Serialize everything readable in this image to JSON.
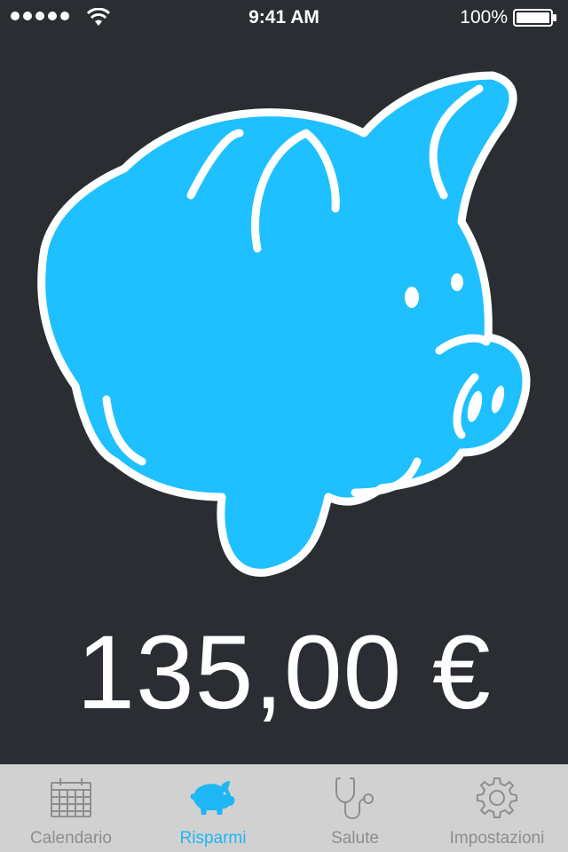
{
  "status_bar": {
    "time": "9:41 AM",
    "battery": "100%"
  },
  "savings": {
    "amount": "135,00 €"
  },
  "tabs": [
    {
      "label": "Calendario",
      "icon": "calendar-icon",
      "active": false
    },
    {
      "label": "Risparmi",
      "icon": "piggy-bank-icon",
      "active": true
    },
    {
      "label": "Salute",
      "icon": "stethoscope-icon",
      "active": false
    },
    {
      "label": "Impostazioni",
      "icon": "gear-icon",
      "active": false
    }
  ],
  "colors": {
    "background": "#2a2e32",
    "accent": "#1fb6f5",
    "pig_fill": "#1ec0ff",
    "tab_bar": "#d1d1d1",
    "tab_inactive": "#8e8e8e"
  }
}
